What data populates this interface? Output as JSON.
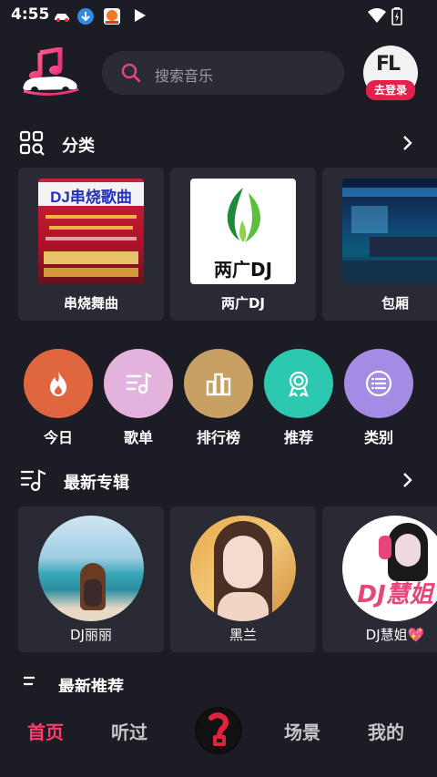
{
  "status_bar": {
    "time": "4:55"
  },
  "header": {
    "search_placeholder": "搜索音乐",
    "avatar_mark": "FL",
    "login_label": "去登录"
  },
  "categories": {
    "title": "分类",
    "items": [
      {
        "label": "串烧舞曲",
        "thumb_title": "DJ串烧歌曲"
      },
      {
        "label": "两广DJ",
        "thumb_title": "两广DJ"
      },
      {
        "label": "包厢"
      }
    ]
  },
  "quick_links": [
    {
      "label": "今日",
      "color": "#e0663f",
      "icon": "flame-icon"
    },
    {
      "label": "歌单",
      "color": "#e3b3de",
      "icon": "playlist-icon"
    },
    {
      "label": "排行榜",
      "color": "#c9a064",
      "icon": "chart-icon"
    },
    {
      "label": "推荐",
      "color": "#2dc8b0",
      "icon": "award-icon"
    },
    {
      "label": "类别",
      "color": "#a48ce4",
      "icon": "list-icon"
    }
  ],
  "albums": {
    "title": "最新专辑",
    "items": [
      {
        "label": "DJ丽丽"
      },
      {
        "label": "黑兰"
      },
      {
        "label": "DJ慧姐💖",
        "disc_text": "DJ慧姐"
      }
    ]
  },
  "next_section": {
    "title": "最新推荐"
  },
  "bottom_nav": {
    "items": [
      "首页",
      "听过",
      "场景",
      "我的"
    ],
    "active_color": "#ff3d6c"
  }
}
